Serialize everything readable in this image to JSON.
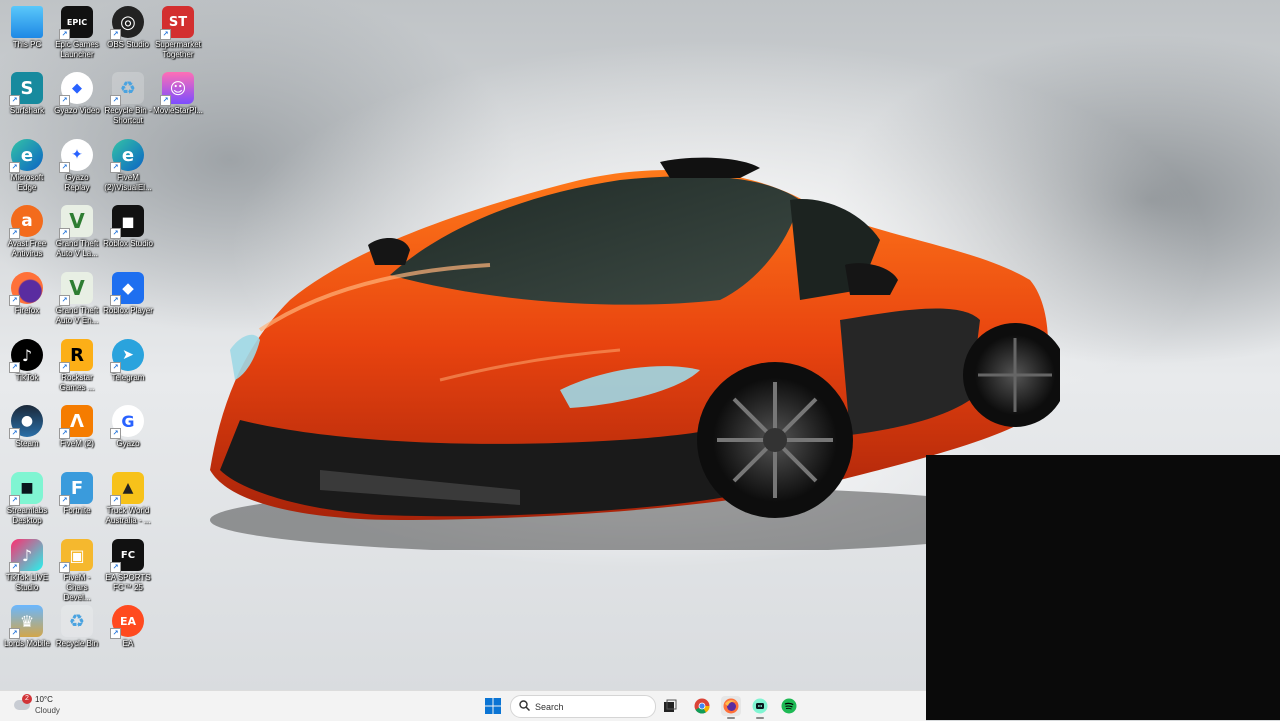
{
  "desktop": {
    "icons": [
      {
        "label": "This PC",
        "icon": "monitor-icon"
      },
      {
        "label": "Epic Games Launcher",
        "icon": "epic-games-icon"
      },
      {
        "label": "OBS Studio",
        "icon": "obs-icon"
      },
      {
        "label": "Supermarket Together",
        "icon": "supermarket-together-icon",
        "glyph": "ST"
      },
      {
        "label": "Surfshark",
        "icon": "surfshark-icon"
      },
      {
        "label": "Gyazo Video",
        "icon": "gyazo-video-icon"
      },
      {
        "label": "Recycle Bin - Shortcut",
        "icon": "recycle-bin-icon"
      },
      {
        "label": "MovieStarPl...",
        "icon": "moviestarplanet-icon"
      },
      {
        "label": "Microsoft Edge",
        "icon": "edge-icon"
      },
      {
        "label": "Gyazo Replay",
        "icon": "gyazo-replay-icon"
      },
      {
        "label": "FiveM (2)\\VisualEl...",
        "icon": "edge-icon"
      },
      {
        "label": "Avast Free Antivirus",
        "icon": "avast-icon"
      },
      {
        "label": "Grand Theft Auto V La...",
        "icon": "gta-v-icon"
      },
      {
        "label": "Roblox Studio",
        "icon": "roblox-studio-icon"
      },
      {
        "label": "Firefox",
        "icon": "firefox-icon"
      },
      {
        "label": "Grand Theft Auto V En...",
        "icon": "gta-v-icon"
      },
      {
        "label": "Roblox Player",
        "icon": "roblox-player-icon"
      },
      {
        "label": "TikTok",
        "icon": "tiktok-icon"
      },
      {
        "label": "Rockstar Games ...",
        "icon": "rockstar-icon"
      },
      {
        "label": "Telegram",
        "icon": "telegram-icon"
      },
      {
        "label": "Steam",
        "icon": "steam-icon"
      },
      {
        "label": "FiveM (2)",
        "icon": "fivem-icon"
      },
      {
        "label": "Gyazo",
        "icon": "gyazo-icon"
      },
      {
        "label": "Streamlabs Desktop",
        "icon": "streamlabs-icon"
      },
      {
        "label": "Fortnite",
        "icon": "fortnite-icon"
      },
      {
        "label": "Truck World Australia - ...",
        "icon": "truck-world-icon"
      },
      {
        "label": "TikTok LIVE Studio",
        "icon": "tiktok-live-icon"
      },
      {
        "label": "FiveM - Chars Devel...",
        "icon": "fivem-box-icon"
      },
      {
        "label": "EA SPORTS FC™ 25",
        "icon": "ea-fc-icon"
      },
      {
        "label": "Lords Mobile",
        "icon": "lords-mobile-icon"
      },
      {
        "label": "Recycle Bin",
        "icon": "recycle-bin-icon"
      },
      {
        "label": "EA",
        "icon": "ea-icon"
      }
    ]
  },
  "taskbar": {
    "weather": {
      "temp": "10°C",
      "condition": "Cloudy",
      "badge": "2"
    },
    "search": {
      "placeholder": "Search"
    },
    "apps": [
      {
        "name": "start-button",
        "icon": "windows-logo-icon"
      },
      {
        "name": "task-view-button",
        "icon": "task-view-icon"
      },
      {
        "name": "chrome-button",
        "icon": "chrome-icon"
      },
      {
        "name": "firefox-button",
        "icon": "firefox-icon"
      },
      {
        "name": "streamlabs-button",
        "icon": "streamlabs-icon"
      },
      {
        "name": "spotify-button",
        "icon": "spotify-icon"
      }
    ]
  },
  "colors": {
    "car_body": "#e8430f",
    "taskbar_bg": "#f3f3f3",
    "black_overlay": "#0a0a0a"
  }
}
